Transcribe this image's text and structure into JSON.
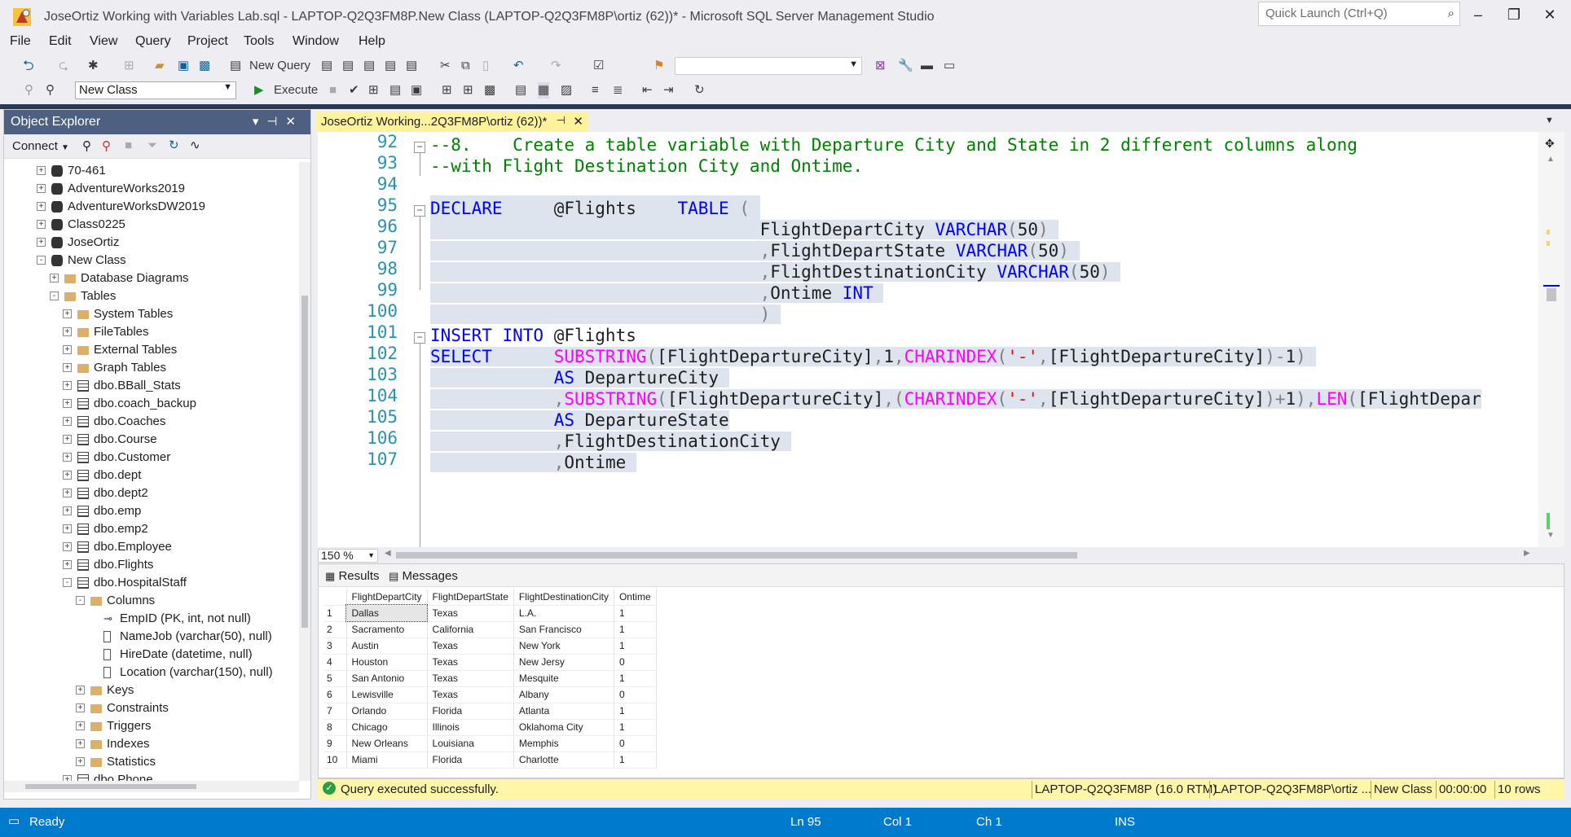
{
  "window": {
    "title": "JoseOrtiz Working with Variables Lab.sql - LAPTOP-Q2Q3FM8P.New Class (LAPTOP-Q2Q3FM8P\\ortiz (62))* - Microsoft SQL Server Management Studio",
    "quick_launch_placeholder": "Quick Launch (Ctrl+Q)",
    "minimize": "–",
    "restore": "❐",
    "close": "✕"
  },
  "menu": [
    "File",
    "Edit",
    "View",
    "Query",
    "Project",
    "Tools",
    "Window",
    "Help"
  ],
  "toolbar": {
    "new_query": "New Query",
    "database": "New Class",
    "execute": "Execute"
  },
  "object_explorer": {
    "title": "Object Explorer",
    "connect": "Connect",
    "tree": [
      {
        "label": "70-461",
        "level": 2,
        "icon": "database-icon",
        "exp": "+"
      },
      {
        "label": "AdventureWorks2019",
        "level": 2,
        "icon": "database-icon",
        "exp": "+"
      },
      {
        "label": "AdventureWorksDW2019",
        "level": 2,
        "icon": "database-icon",
        "exp": "+"
      },
      {
        "label": "Class0225",
        "level": 2,
        "icon": "database-icon",
        "exp": "+"
      },
      {
        "label": "JoseOrtiz",
        "level": 2,
        "icon": "database-icon",
        "exp": "+"
      },
      {
        "label": "New Class",
        "level": 2,
        "icon": "database-icon",
        "exp": "-"
      },
      {
        "label": "Database Diagrams",
        "level": 3,
        "icon": "folder-icon",
        "exp": "+"
      },
      {
        "label": "Tables",
        "level": 3,
        "icon": "folder-icon",
        "exp": "-"
      },
      {
        "label": "System Tables",
        "level": 4,
        "icon": "folder-icon",
        "exp": "+"
      },
      {
        "label": "FileTables",
        "level": 4,
        "icon": "folder-icon",
        "exp": "+"
      },
      {
        "label": "External Tables",
        "level": 4,
        "icon": "folder-icon",
        "exp": "+"
      },
      {
        "label": "Graph Tables",
        "level": 4,
        "icon": "folder-icon",
        "exp": "+"
      },
      {
        "label": "dbo.BBall_Stats",
        "level": 4,
        "icon": "table-icon",
        "exp": "+"
      },
      {
        "label": "dbo.coach_backup",
        "level": 4,
        "icon": "table-icon",
        "exp": "+"
      },
      {
        "label": "dbo.Coaches",
        "level": 4,
        "icon": "table-icon",
        "exp": "+"
      },
      {
        "label": "dbo.Course",
        "level": 4,
        "icon": "table-icon",
        "exp": "+"
      },
      {
        "label": "dbo.Customer",
        "level": 4,
        "icon": "table-icon",
        "exp": "+"
      },
      {
        "label": "dbo.dept",
        "level": 4,
        "icon": "table-icon",
        "exp": "+"
      },
      {
        "label": "dbo.dept2",
        "level": 4,
        "icon": "table-icon",
        "exp": "+"
      },
      {
        "label": "dbo.emp",
        "level": 4,
        "icon": "table-icon",
        "exp": "+"
      },
      {
        "label": "dbo.emp2",
        "level": 4,
        "icon": "table-icon",
        "exp": "+"
      },
      {
        "label": "dbo.Employee",
        "level": 4,
        "icon": "table-icon",
        "exp": "+"
      },
      {
        "label": "dbo.Flights",
        "level": 4,
        "icon": "table-icon",
        "exp": "+"
      },
      {
        "label": "dbo.HospitalStaff",
        "level": 4,
        "icon": "table-icon",
        "exp": "-"
      },
      {
        "label": "Columns",
        "level": 5,
        "icon": "folder-icon",
        "exp": "-"
      },
      {
        "label": "EmpID (PK, int, not null)",
        "level": 6,
        "icon": "key-icon",
        "exp": ""
      },
      {
        "label": "NameJob (varchar(50), null)",
        "level": 6,
        "icon": "column-icon",
        "exp": ""
      },
      {
        "label": "HireDate (datetime, null)",
        "level": 6,
        "icon": "column-icon",
        "exp": ""
      },
      {
        "label": "Location (varchar(150), null)",
        "level": 6,
        "icon": "column-icon",
        "exp": ""
      },
      {
        "label": "Keys",
        "level": 5,
        "icon": "folder-icon",
        "exp": "+"
      },
      {
        "label": "Constraints",
        "level": 5,
        "icon": "folder-icon",
        "exp": "+"
      },
      {
        "label": "Triggers",
        "level": 5,
        "icon": "folder-icon",
        "exp": "+"
      },
      {
        "label": "Indexes",
        "level": 5,
        "icon": "folder-icon",
        "exp": "+"
      },
      {
        "label": "Statistics",
        "level": 5,
        "icon": "folder-icon",
        "exp": "+"
      },
      {
        "label": "dbo.Phone",
        "level": 4,
        "icon": "table-icon",
        "exp": "+"
      }
    ]
  },
  "document_tab": {
    "label": "JoseOrtiz Working...2Q3FM8P\\ortiz (62))*",
    "pin": "⊣",
    "close": "✕"
  },
  "editor": {
    "line_numbers": [
      "92",
      "93",
      "94",
      "95",
      "96",
      "97",
      "98",
      "99",
      "100",
      "101",
      "102",
      "103",
      "104",
      "105",
      "106",
      "107"
    ],
    "zoom": "150 %"
  },
  "results": {
    "tab_results": "Results",
    "tab_messages": "Messages",
    "columns": [
      "FlightDepartCity",
      "FlightDepartState",
      "FlightDestinationCity",
      "Ontime"
    ],
    "rows": [
      [
        "1",
        "Dallas",
        "Texas",
        "L.A.",
        "1"
      ],
      [
        "2",
        "Sacramento",
        "California",
        "San Francisco",
        "1"
      ],
      [
        "3",
        "Austin",
        "Texas",
        "New York",
        "1"
      ],
      [
        "4",
        "Houston",
        "Texas",
        "New Jersy",
        "0"
      ],
      [
        "5",
        "San Antonio",
        "Texas",
        "Mesquite",
        "1"
      ],
      [
        "6",
        "Lewisville",
        "Texas",
        "Albany",
        "0"
      ],
      [
        "7",
        "Orlando",
        "Florida",
        "Atlanta",
        "1"
      ],
      [
        "8",
        "Chicago",
        "Illinois",
        "Oklahoma City",
        "1"
      ],
      [
        "9",
        "New Orleans",
        "Louisiana",
        "Memphis",
        "0"
      ],
      [
        "10",
        "Miami",
        "Florida",
        "Charlotte",
        "1"
      ]
    ]
  },
  "query_status": {
    "message": "Query executed successfully.",
    "server": "LAPTOP-Q2Q3FM8P (16.0 RTM)",
    "user": "LAPTOP-Q2Q3FM8P\\ortiz ...",
    "database": "New Class",
    "elapsed": "00:00:00",
    "rows": "10 rows"
  },
  "status_bar": {
    "ready": "Ready",
    "ln": "Ln 95",
    "col": "Col 1",
    "ch": "Ch 1",
    "mode": "INS"
  },
  "colors": {
    "accent_blue": "#007acc",
    "oe_header": "#4d6082",
    "tab_yellow": "#fff29d",
    "keyword": "#0000ff",
    "function": "#ff00ff",
    "comment": "#008000",
    "string": "#ff0000"
  }
}
